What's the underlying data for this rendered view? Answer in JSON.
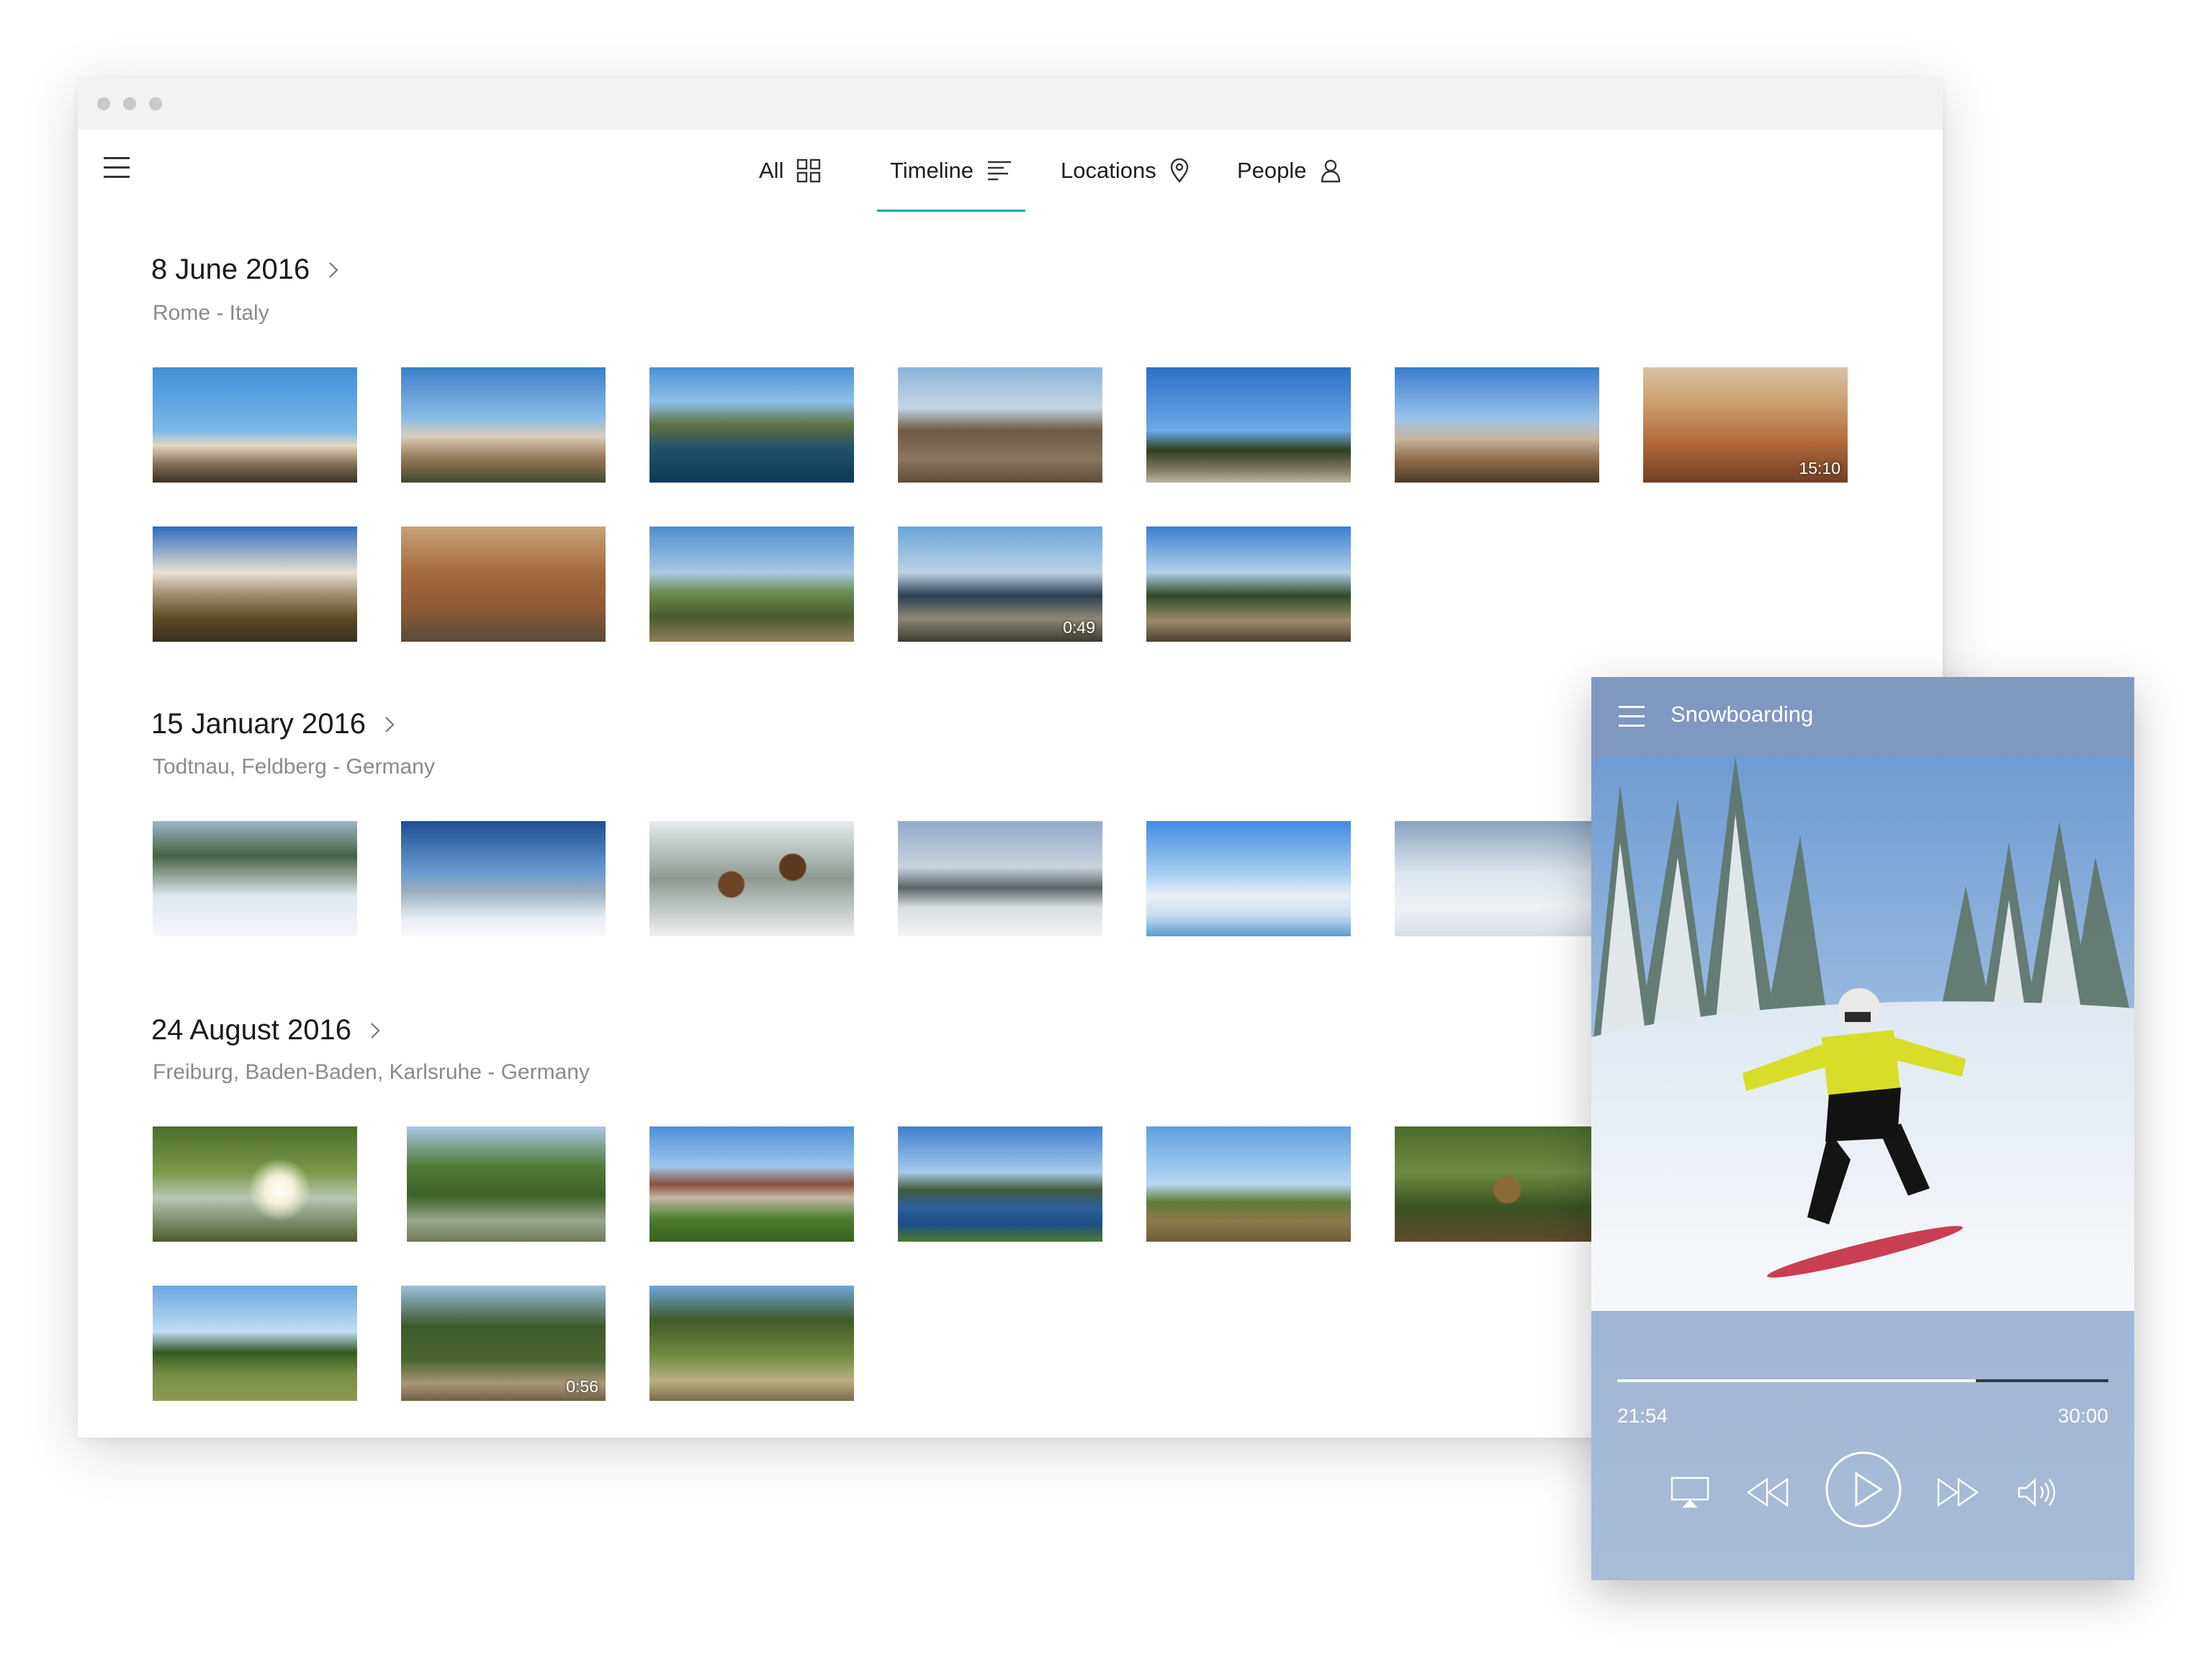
{
  "nav": {
    "tabs": [
      {
        "label": "All",
        "icon": "grid-icon"
      },
      {
        "label": "Timeline",
        "icon": "timeline-icon",
        "active": true
      },
      {
        "label": "Locations",
        "icon": "location-pin-icon"
      },
      {
        "label": "People",
        "icon": "person-icon"
      }
    ],
    "accent_color": "#1aa3b8"
  },
  "sections": [
    {
      "date": "8 June 2016",
      "location": "Rome - Italy",
      "thumbs": [
        {
          "duration": ""
        },
        {
          "duration": ""
        },
        {
          "duration": ""
        },
        {
          "duration": ""
        },
        {
          "duration": ""
        },
        {
          "duration": ""
        },
        {
          "duration": "15:10"
        },
        {
          "duration": ""
        },
        {
          "duration": ""
        },
        {
          "duration": ""
        },
        {
          "duration": "0:49"
        },
        {
          "duration": ""
        }
      ]
    },
    {
      "date": "15 January 2016",
      "location": "Todtnau, Feldberg - Germany",
      "thumbs": [
        {
          "duration": ""
        },
        {
          "duration": ""
        },
        {
          "duration": ""
        },
        {
          "duration": ""
        },
        {
          "duration": ""
        },
        {
          "duration": ""
        }
      ]
    },
    {
      "date": "24 August 2016",
      "location": "Freiburg, Baden-Baden, Karlsruhe - Germany",
      "thumbs": [
        {
          "duration": ""
        },
        {
          "duration": ""
        },
        {
          "duration": ""
        },
        {
          "duration": ""
        },
        {
          "duration": ""
        },
        {
          "duration": ""
        },
        {
          "duration": ""
        },
        {
          "duration": "0:56"
        },
        {
          "duration": ""
        }
      ]
    }
  ],
  "player": {
    "title": "Snowboarding",
    "current_time": "21:54",
    "total_time": "30:00",
    "progress": 0.73,
    "controls": [
      "cast-icon",
      "rewind-icon",
      "play-icon",
      "fast-forward-icon",
      "volume-icon"
    ]
  }
}
